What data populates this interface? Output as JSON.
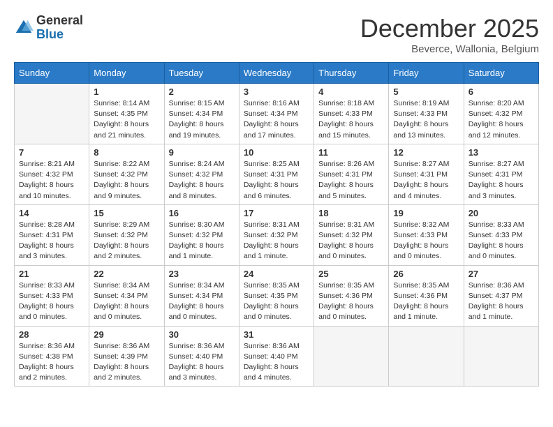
{
  "header": {
    "logo_general": "General",
    "logo_blue": "Blue",
    "month_title": "December 2025",
    "location": "Beverce, Wallonia, Belgium"
  },
  "calendar": {
    "days_of_week": [
      "Sunday",
      "Monday",
      "Tuesday",
      "Wednesday",
      "Thursday",
      "Friday",
      "Saturday"
    ],
    "weeks": [
      [
        {
          "day": "",
          "info": ""
        },
        {
          "day": "1",
          "info": "Sunrise: 8:14 AM\nSunset: 4:35 PM\nDaylight: 8 hours\nand 21 minutes."
        },
        {
          "day": "2",
          "info": "Sunrise: 8:15 AM\nSunset: 4:34 PM\nDaylight: 8 hours\nand 19 minutes."
        },
        {
          "day": "3",
          "info": "Sunrise: 8:16 AM\nSunset: 4:34 PM\nDaylight: 8 hours\nand 17 minutes."
        },
        {
          "day": "4",
          "info": "Sunrise: 8:18 AM\nSunset: 4:33 PM\nDaylight: 8 hours\nand 15 minutes."
        },
        {
          "day": "5",
          "info": "Sunrise: 8:19 AM\nSunset: 4:33 PM\nDaylight: 8 hours\nand 13 minutes."
        },
        {
          "day": "6",
          "info": "Sunrise: 8:20 AM\nSunset: 4:32 PM\nDaylight: 8 hours\nand 12 minutes."
        }
      ],
      [
        {
          "day": "7",
          "info": "Sunrise: 8:21 AM\nSunset: 4:32 PM\nDaylight: 8 hours\nand 10 minutes."
        },
        {
          "day": "8",
          "info": "Sunrise: 8:22 AM\nSunset: 4:32 PM\nDaylight: 8 hours\nand 9 minutes."
        },
        {
          "day": "9",
          "info": "Sunrise: 8:24 AM\nSunset: 4:32 PM\nDaylight: 8 hours\nand 8 minutes."
        },
        {
          "day": "10",
          "info": "Sunrise: 8:25 AM\nSunset: 4:31 PM\nDaylight: 8 hours\nand 6 minutes."
        },
        {
          "day": "11",
          "info": "Sunrise: 8:26 AM\nSunset: 4:31 PM\nDaylight: 8 hours\nand 5 minutes."
        },
        {
          "day": "12",
          "info": "Sunrise: 8:27 AM\nSunset: 4:31 PM\nDaylight: 8 hours\nand 4 minutes."
        },
        {
          "day": "13",
          "info": "Sunrise: 8:27 AM\nSunset: 4:31 PM\nDaylight: 8 hours\nand 3 minutes."
        }
      ],
      [
        {
          "day": "14",
          "info": "Sunrise: 8:28 AM\nSunset: 4:31 PM\nDaylight: 8 hours\nand 3 minutes."
        },
        {
          "day": "15",
          "info": "Sunrise: 8:29 AM\nSunset: 4:32 PM\nDaylight: 8 hours\nand 2 minutes."
        },
        {
          "day": "16",
          "info": "Sunrise: 8:30 AM\nSunset: 4:32 PM\nDaylight: 8 hours\nand 1 minute."
        },
        {
          "day": "17",
          "info": "Sunrise: 8:31 AM\nSunset: 4:32 PM\nDaylight: 8 hours\nand 1 minute."
        },
        {
          "day": "18",
          "info": "Sunrise: 8:31 AM\nSunset: 4:32 PM\nDaylight: 8 hours\nand 0 minutes."
        },
        {
          "day": "19",
          "info": "Sunrise: 8:32 AM\nSunset: 4:33 PM\nDaylight: 8 hours\nand 0 minutes."
        },
        {
          "day": "20",
          "info": "Sunrise: 8:33 AM\nSunset: 4:33 PM\nDaylight: 8 hours\nand 0 minutes."
        }
      ],
      [
        {
          "day": "21",
          "info": "Sunrise: 8:33 AM\nSunset: 4:33 PM\nDaylight: 8 hours\nand 0 minutes."
        },
        {
          "day": "22",
          "info": "Sunrise: 8:34 AM\nSunset: 4:34 PM\nDaylight: 8 hours\nand 0 minutes."
        },
        {
          "day": "23",
          "info": "Sunrise: 8:34 AM\nSunset: 4:34 PM\nDaylight: 8 hours\nand 0 minutes."
        },
        {
          "day": "24",
          "info": "Sunrise: 8:35 AM\nSunset: 4:35 PM\nDaylight: 8 hours\nand 0 minutes."
        },
        {
          "day": "25",
          "info": "Sunrise: 8:35 AM\nSunset: 4:36 PM\nDaylight: 8 hours\nand 0 minutes."
        },
        {
          "day": "26",
          "info": "Sunrise: 8:35 AM\nSunset: 4:36 PM\nDaylight: 8 hours\nand 1 minute."
        },
        {
          "day": "27",
          "info": "Sunrise: 8:36 AM\nSunset: 4:37 PM\nDaylight: 8 hours\nand 1 minute."
        }
      ],
      [
        {
          "day": "28",
          "info": "Sunrise: 8:36 AM\nSunset: 4:38 PM\nDaylight: 8 hours\nand 2 minutes."
        },
        {
          "day": "29",
          "info": "Sunrise: 8:36 AM\nSunset: 4:39 PM\nDaylight: 8 hours\nand 2 minutes."
        },
        {
          "day": "30",
          "info": "Sunrise: 8:36 AM\nSunset: 4:40 PM\nDaylight: 8 hours\nand 3 minutes."
        },
        {
          "day": "31",
          "info": "Sunrise: 8:36 AM\nSunset: 4:40 PM\nDaylight: 8 hours\nand 4 minutes."
        },
        {
          "day": "",
          "info": ""
        },
        {
          "day": "",
          "info": ""
        },
        {
          "day": "",
          "info": ""
        }
      ]
    ]
  }
}
